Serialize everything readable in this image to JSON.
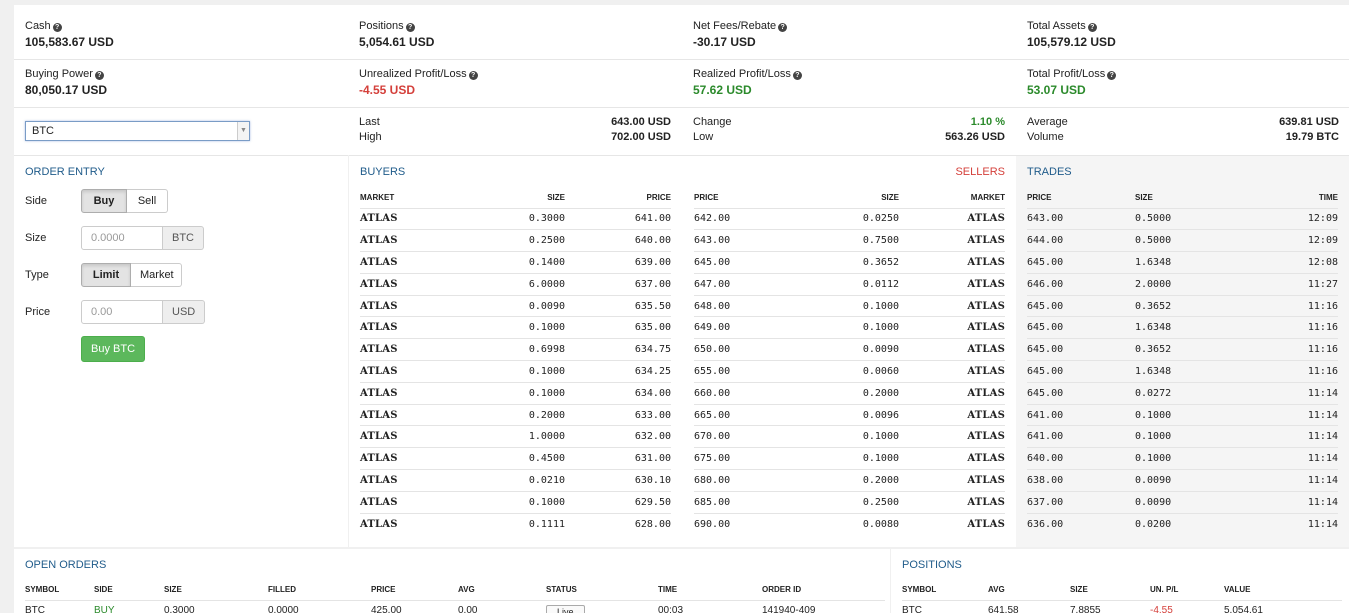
{
  "stats": {
    "cash": {
      "label": "Cash",
      "value": "105,583.67 USD"
    },
    "positions": {
      "label": "Positions",
      "value": "5,054.61 USD"
    },
    "net_fees": {
      "label": "Net Fees/Rebate",
      "value": "-30.17 USD"
    },
    "total_assets": {
      "label": "Total Assets",
      "value": "105,579.12 USD"
    },
    "buying_power": {
      "label": "Buying Power",
      "value": "80,050.17 USD"
    },
    "unrealized": {
      "label": "Unrealized Profit/Loss",
      "value": "-4.55 USD"
    },
    "realized": {
      "label": "Realized Profit/Loss",
      "value": "57.62 USD"
    },
    "total_pl": {
      "label": "Total Profit/Loss",
      "value": "53.07 USD"
    }
  },
  "symbol_select": {
    "value": "BTC"
  },
  "market": {
    "last": {
      "label": "Last",
      "value": "643.00 USD"
    },
    "high": {
      "label": "High",
      "value": "702.00 USD"
    },
    "change": {
      "label": "Change",
      "value": "1.10 %"
    },
    "low": {
      "label": "Low",
      "value": "563.26 USD"
    },
    "average": {
      "label": "Average",
      "value": "639.81 USD"
    },
    "volume": {
      "label": "Volume",
      "value": "19.79 BTC"
    }
  },
  "order_entry": {
    "title": "ORDER ENTRY",
    "side_label": "Side",
    "buy": "Buy",
    "sell": "Sell",
    "size_label": "Size",
    "size_placeholder": "0.0000",
    "size_unit": "BTC",
    "type_label": "Type",
    "limit": "Limit",
    "market": "Market",
    "price_label": "Price",
    "price_placeholder": "0.00",
    "price_unit": "USD",
    "submit": "Buy BTC"
  },
  "buyers": {
    "title": "BUYERS",
    "headers": [
      "MARKET",
      "SIZE",
      "PRICE"
    ],
    "rows": [
      [
        "ATLAS",
        "0.3000",
        "641.00"
      ],
      [
        "ATLAS",
        "0.2500",
        "640.00"
      ],
      [
        "ATLAS",
        "0.1400",
        "639.00"
      ],
      [
        "ATLAS",
        "6.0000",
        "637.00"
      ],
      [
        "ATLAS",
        "0.0090",
        "635.50"
      ],
      [
        "ATLAS",
        "0.1000",
        "635.00"
      ],
      [
        "ATLAS",
        "0.6998",
        "634.75"
      ],
      [
        "ATLAS",
        "0.1000",
        "634.25"
      ],
      [
        "ATLAS",
        "0.1000",
        "634.00"
      ],
      [
        "ATLAS",
        "0.2000",
        "633.00"
      ],
      [
        "ATLAS",
        "1.0000",
        "632.00"
      ],
      [
        "ATLAS",
        "0.4500",
        "631.00"
      ],
      [
        "ATLAS",
        "0.0210",
        "630.10"
      ],
      [
        "ATLAS",
        "0.1000",
        "629.50"
      ],
      [
        "ATLAS",
        "0.1111",
        "628.00"
      ]
    ]
  },
  "sellers": {
    "title": "SELLERS",
    "headers": [
      "PRICE",
      "SIZE",
      "MARKET"
    ],
    "rows": [
      [
        "642.00",
        "0.0250",
        "ATLAS"
      ],
      [
        "643.00",
        "0.7500",
        "ATLAS"
      ],
      [
        "645.00",
        "0.3652",
        "ATLAS"
      ],
      [
        "647.00",
        "0.0112",
        "ATLAS"
      ],
      [
        "648.00",
        "0.1000",
        "ATLAS"
      ],
      [
        "649.00",
        "0.1000",
        "ATLAS"
      ],
      [
        "650.00",
        "0.0090",
        "ATLAS"
      ],
      [
        "655.00",
        "0.0060",
        "ATLAS"
      ],
      [
        "660.00",
        "0.2000",
        "ATLAS"
      ],
      [
        "665.00",
        "0.0096",
        "ATLAS"
      ],
      [
        "670.00",
        "0.1000",
        "ATLAS"
      ],
      [
        "675.00",
        "0.1000",
        "ATLAS"
      ],
      [
        "680.00",
        "0.2000",
        "ATLAS"
      ],
      [
        "685.00",
        "0.2500",
        "ATLAS"
      ],
      [
        "690.00",
        "0.0080",
        "ATLAS"
      ]
    ]
  },
  "trades": {
    "title": "TRADES",
    "headers": [
      "PRICE",
      "SIZE",
      "TIME"
    ],
    "rows": [
      [
        "643.00",
        "0.5000",
        "12:09"
      ],
      [
        "644.00",
        "0.5000",
        "12:09"
      ],
      [
        "645.00",
        "1.6348",
        "12:08"
      ],
      [
        "646.00",
        "2.0000",
        "11:27"
      ],
      [
        "645.00",
        "0.3652",
        "11:16"
      ],
      [
        "645.00",
        "1.6348",
        "11:16"
      ],
      [
        "645.00",
        "0.3652",
        "11:16"
      ],
      [
        "645.00",
        "1.6348",
        "11:16"
      ],
      [
        "645.00",
        "0.0272",
        "11:14"
      ],
      [
        "641.00",
        "0.1000",
        "11:14"
      ],
      [
        "641.00",
        "0.1000",
        "11:14"
      ],
      [
        "640.00",
        "0.1000",
        "11:14"
      ],
      [
        "638.00",
        "0.0090",
        "11:14"
      ],
      [
        "637.00",
        "0.0090",
        "11:14"
      ],
      [
        "636.00",
        "0.0200",
        "11:14"
      ]
    ]
  },
  "open_orders": {
    "title": "OPEN ORDERS",
    "headers": [
      "SYMBOL",
      "SIDE",
      "SIZE",
      "FILLED",
      "PRICE",
      "AVG",
      "STATUS",
      "TIME",
      "ORDER ID"
    ],
    "rows": [
      {
        "symbol": "BTC",
        "side": "BUY",
        "size": "0.3000",
        "filled": "0.0000",
        "price": "425.00",
        "avg": "0.00",
        "status": "Live",
        "time": "00:03",
        "order_id": "141940-409"
      }
    ]
  },
  "positions_table": {
    "title": "POSITIONS",
    "headers": [
      "SYMBOL",
      "AVG",
      "SIZE",
      "UN. P/L",
      "VALUE"
    ],
    "rows": [
      {
        "symbol": "BTC",
        "avg": "641.58",
        "size": "7.8855",
        "unpl": "-4.55",
        "value": "5,054.61"
      }
    ]
  },
  "colors": {
    "accent": "#1f5b8a",
    "negative": "#d43f3a",
    "positive": "#2b8a2b",
    "buy_button": "#5cb85c"
  }
}
